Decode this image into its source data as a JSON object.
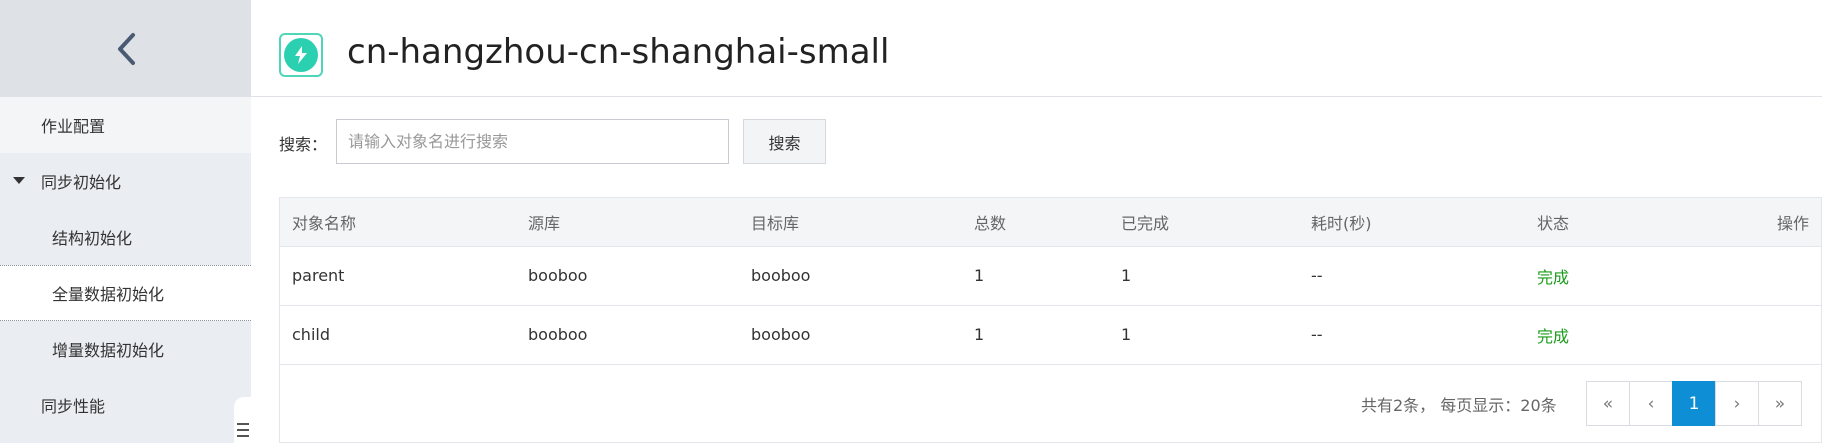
{
  "sidebar": {
    "back_icon": "chevron-left-icon",
    "items": [
      {
        "label": "作业配置"
      },
      {
        "label": "同步初始化"
      },
      {
        "label": "结构初始化"
      },
      {
        "label": "全量数据初始化"
      },
      {
        "label": "增量数据初始化"
      },
      {
        "label": "同步性能"
      }
    ]
  },
  "header": {
    "title": "cn-hangzhou-cn-shanghai-small",
    "logo_icon": "cloud-lightning-icon",
    "logo_color": "#2bd0b1"
  },
  "search": {
    "label": "搜索：",
    "placeholder": "请输入对象名进行搜索",
    "value": "",
    "button_label": "搜索"
  },
  "table": {
    "columns": [
      "对象名称",
      "源库",
      "目标库",
      "总数",
      "已完成",
      "耗时(秒)",
      "状态",
      "操作"
    ],
    "rows": [
      {
        "name": "parent",
        "source": "booboo",
        "target": "booboo",
        "total": "1",
        "done": "1",
        "time": "--",
        "status": "完成",
        "op": ""
      },
      {
        "name": "child",
        "source": "booboo",
        "target": "booboo",
        "total": "1",
        "done": "1",
        "time": "--",
        "status": "完成",
        "op": ""
      }
    ]
  },
  "pagination": {
    "info": "共有2条， 每页显示：20条",
    "first": "«",
    "prev": "‹",
    "current": "1",
    "next": "›",
    "last": "»"
  },
  "colors": {
    "accent": "#0e8fd5",
    "status_done": "#1a9c1a"
  }
}
